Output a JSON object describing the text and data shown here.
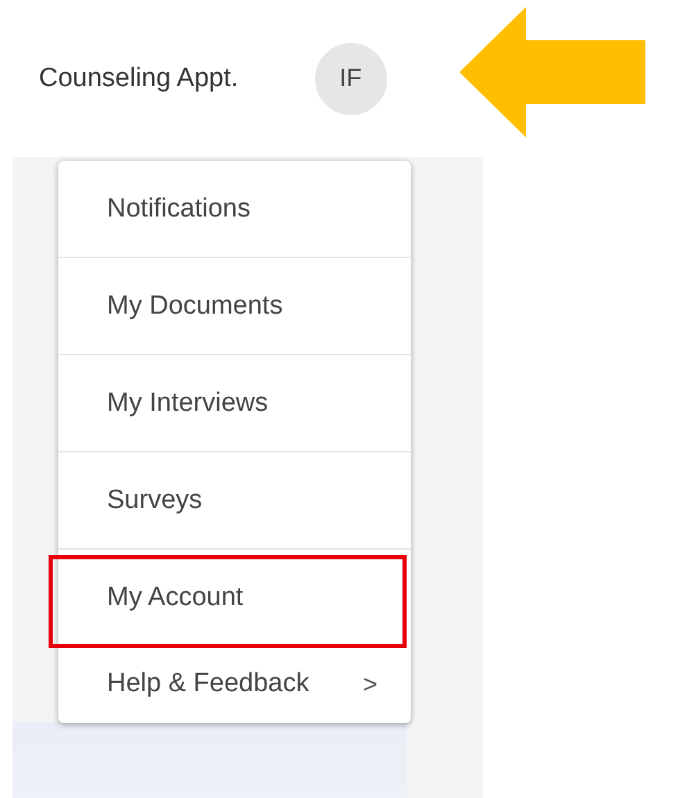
{
  "header": {
    "title": "Counseling Appt.",
    "avatar": "IF",
    "pointer_arrow": true
  },
  "menu": {
    "items": [
      {
        "label": "Notifications",
        "kind": "link",
        "highlighted": false
      },
      {
        "label": "My Documents",
        "kind": "link",
        "highlighted": false
      },
      {
        "label": "My Interviews",
        "kind": "link",
        "highlighted": false
      },
      {
        "label": "Surveys",
        "kind": "link",
        "highlighted": false
      },
      {
        "label": "My Account",
        "kind": "link",
        "highlighted": true
      },
      {
        "label": "Help & Feedback",
        "kind": "submenu",
        "highlighted": false,
        "chevron": ">"
      }
    ]
  }
}
